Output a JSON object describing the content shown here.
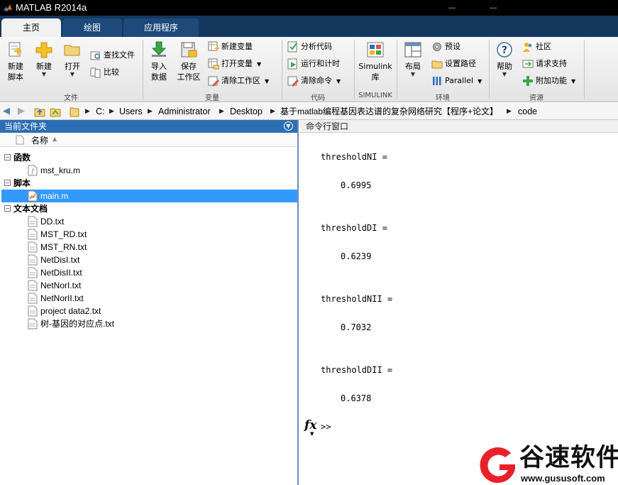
{
  "window": {
    "title": "MATLAB R2014a"
  },
  "tabs": [
    {
      "label": "主页",
      "active": true
    },
    {
      "label": "绘图",
      "active": false
    },
    {
      "label": "应用程序",
      "active": false
    }
  ],
  "ribbon": {
    "file": {
      "label": "文件",
      "new_script": "新建\n脚本",
      "new": "新建",
      "open": "打开",
      "find_files": "查找文件",
      "compare": "比较"
    },
    "variable": {
      "label": "变量",
      "import": "导入\n数据",
      "save_workspace": "保存\n工作区",
      "new_variable": "新建变量",
      "open_variable": "打开变量",
      "clear_workspace": "清除工作区"
    },
    "code": {
      "label": "代码",
      "analyze": "分析代码",
      "run_time": "运行和计时",
      "clear_commands": "清除命令"
    },
    "simulink": {
      "label": "SIMULINK",
      "library": "Simulink\n库"
    },
    "environment": {
      "label": "环境",
      "layout": "布局",
      "preferences": "预设",
      "set_path": "设置路径",
      "parallel": "Parallel"
    },
    "resources": {
      "label": "资源",
      "help": "帮助",
      "community": "社区",
      "request_support": "请求支持",
      "addons": "附加功能"
    }
  },
  "address": {
    "path": [
      "C:",
      "Users",
      "Administrator",
      "Desktop",
      "基于matlab编程基因表达谱的复杂网络研究【程序+论文】",
      "code"
    ]
  },
  "current_folder": {
    "title": "当前文件夹",
    "column_name": "名称",
    "groups": [
      {
        "label": "函数",
        "files": [
          "mst_kru.m"
        ]
      },
      {
        "label": "脚本",
        "files": [
          "main.m"
        ]
      },
      {
        "label": "文本文档",
        "files": [
          "DD.txt",
          "MST_RD.txt",
          "MST_RN.txt",
          "NetDisI.txt",
          "NetDisII.txt",
          "NetNorI.txt",
          "NetNorII.txt",
          "project data2.txt",
          "树-基因的对应点.txt"
        ]
      }
    ],
    "selected_file": "main.m"
  },
  "command_window": {
    "title": "命令行窗口",
    "outputs": [
      {
        "name": "thresholdNI =",
        "value": "0.6995"
      },
      {
        "name": "thresholdDI =",
        "value": "0.6239"
      },
      {
        "name": "thresholdNII =",
        "value": "0.7032"
      },
      {
        "name": "thresholdDII =",
        "value": "0.6378"
      }
    ],
    "fx": "fx",
    "prompt": ">>"
  },
  "watermark": {
    "brand": "谷速软件",
    "url": "www.gususoft.com",
    "color": "#e8202a"
  }
}
